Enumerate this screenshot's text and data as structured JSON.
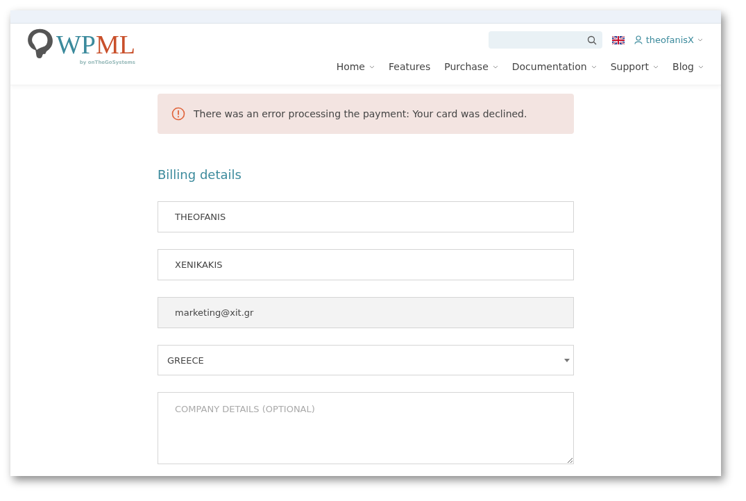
{
  "logo": {
    "part_a": "WP",
    "part_b": "ML",
    "byline": "by onTheGoSystems"
  },
  "user": {
    "name": "theofanisX"
  },
  "nav": [
    {
      "label": "Home",
      "dropdown": true
    },
    {
      "label": "Features",
      "dropdown": false
    },
    {
      "label": "Purchase",
      "dropdown": true
    },
    {
      "label": "Documentation",
      "dropdown": true
    },
    {
      "label": "Support",
      "dropdown": true
    },
    {
      "label": "Blog",
      "dropdown": true
    }
  ],
  "alert": {
    "message": "There was an error processing the payment: Your card was declined."
  },
  "section_title": "Billing details",
  "fields": [
    {
      "kind": "text",
      "value": "THEOFANIS"
    },
    {
      "kind": "text",
      "value": "XENIKAKIS"
    },
    {
      "kind": "readonly",
      "value": "marketing@xit.gr"
    },
    {
      "kind": "select",
      "value": "GREECE"
    },
    {
      "kind": "textarea",
      "placeholder": "COMPANY DETAILS (OPTIONAL)"
    }
  ]
}
